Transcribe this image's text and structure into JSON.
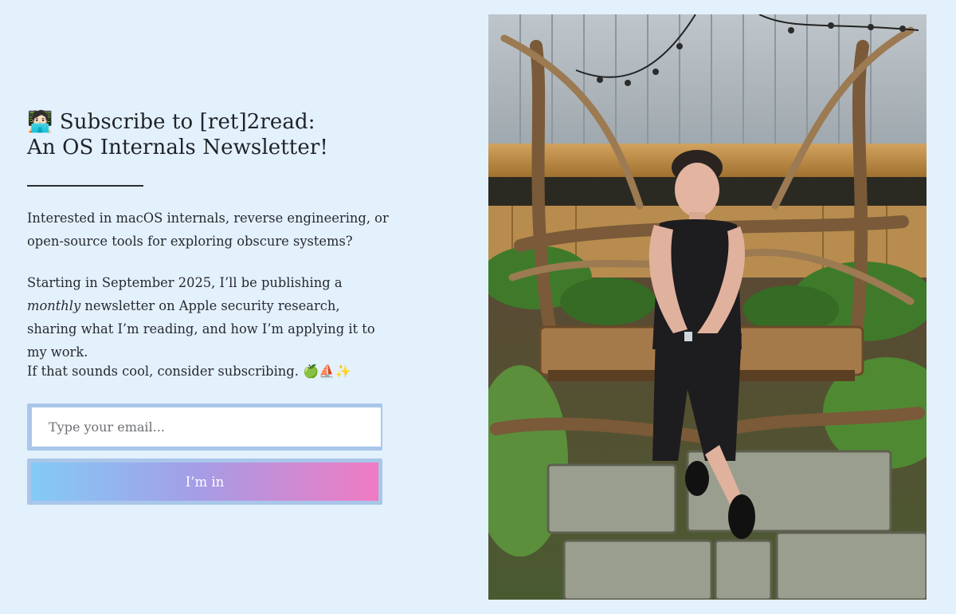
{
  "newsletter": {
    "emoji": "🧑🏻‍💻",
    "title_line1": "Subscribe to [ret]2read:",
    "title_line2": "An OS Internals Newsletter!",
    "intro": "Interested in macOS internals, reverse engineering, or open-source tools for exploring obscure systems?",
    "schedule_before": "Starting in September 2025, I’ll be publishing a",
    "schedule_emphasis": "monthly",
    "schedule_after": "newsletter on Apple security research, sharing what I’m reading, and how I’m applying it to my work.",
    "cta_text": "If that sounds cool, consider subscribing.",
    "cta_emojis": "🍏⛵✨"
  },
  "form": {
    "email_placeholder": "Type your email...",
    "email_value": "",
    "submit_label": "I’m in"
  },
  "photo": {
    "alt": "Author sitting on a rustic wooden bench in a garden"
  },
  "colors": {
    "page_background": "#e3f1fd",
    "button_gradient": [
      "#83cbf6",
      "#a59de6",
      "#f17ac2"
    ],
    "field_border": "#a9c6ea"
  }
}
